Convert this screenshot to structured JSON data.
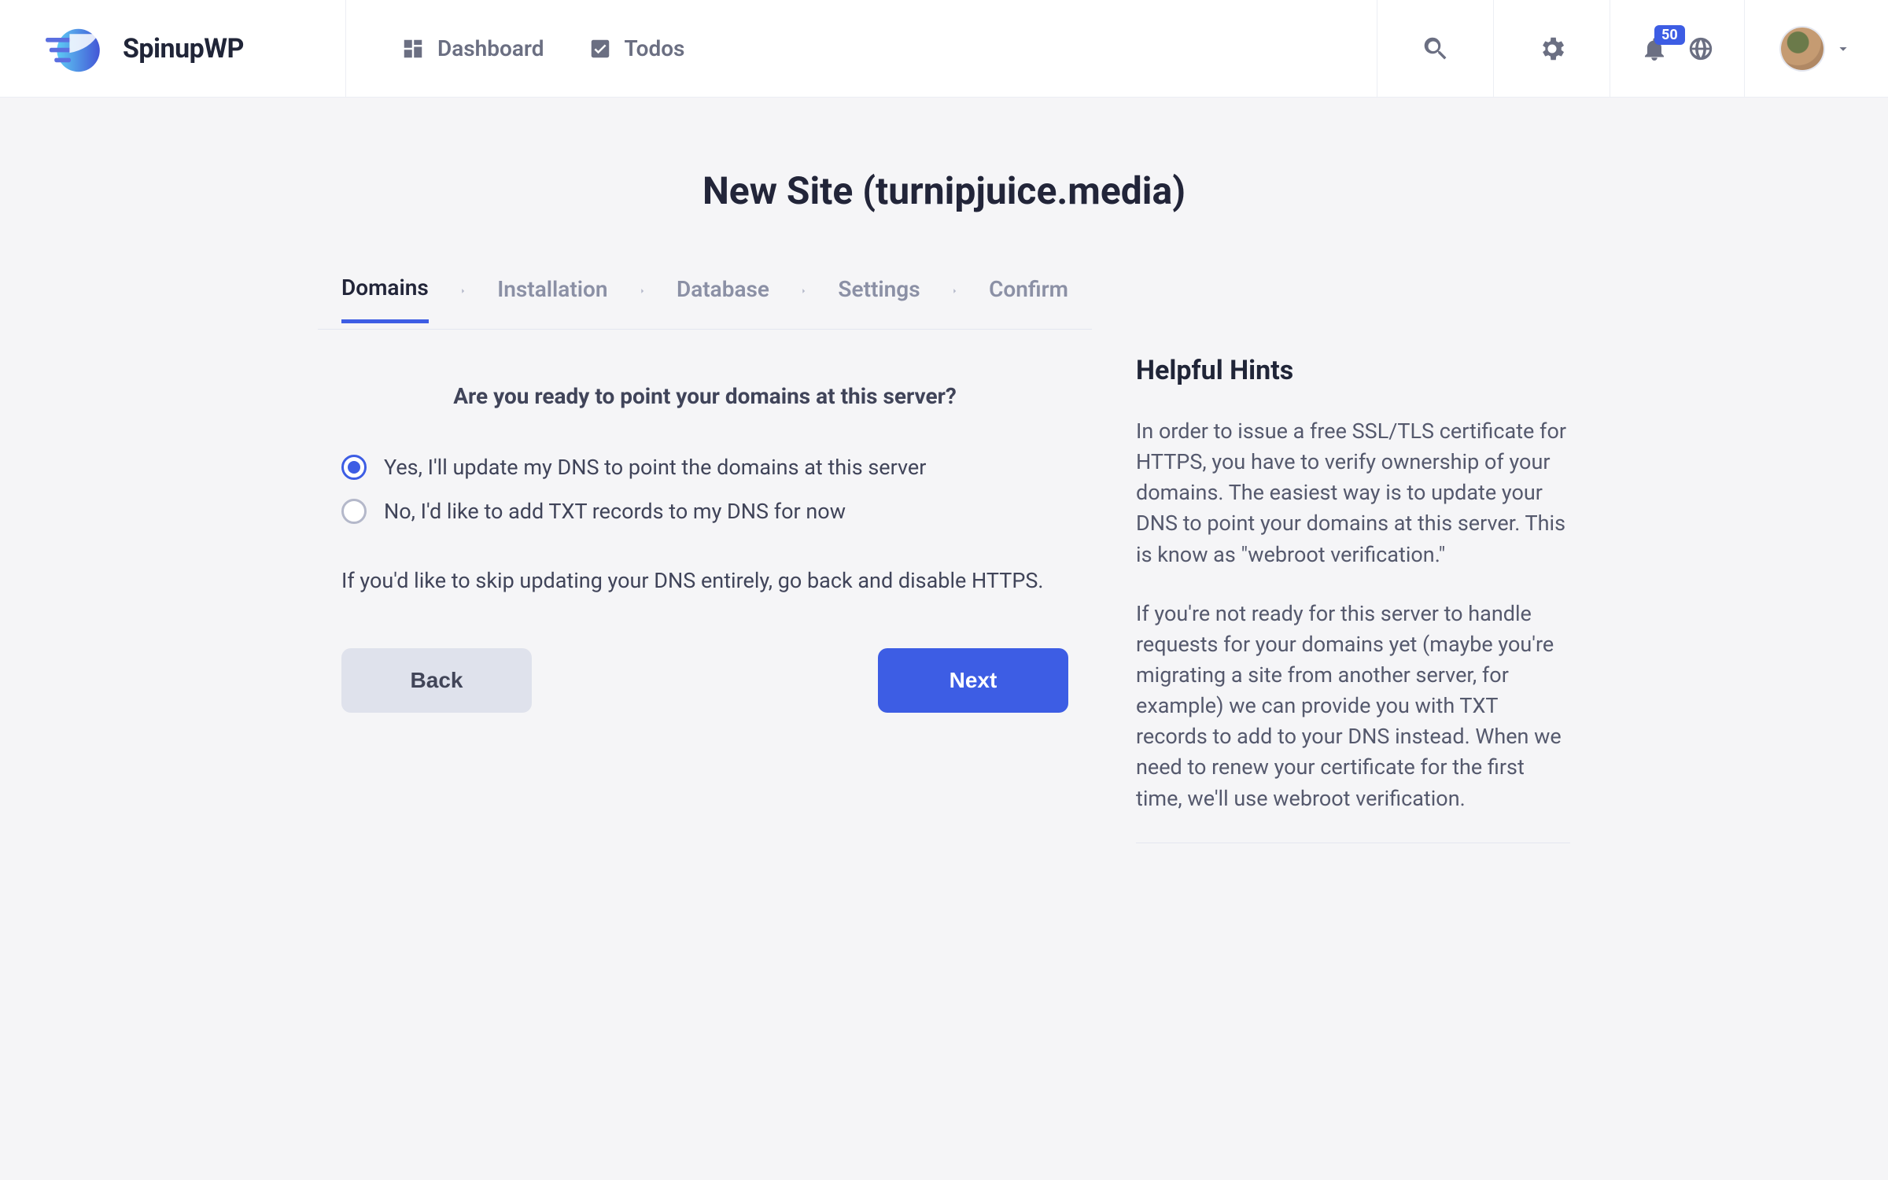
{
  "brand": "SpinupWP",
  "nav": {
    "dashboard": "Dashboard",
    "todos": "Todos"
  },
  "notification_count": "50",
  "page_title": "New Site (turnipjuice.media)",
  "steps": {
    "domains": "Domains",
    "installation": "Installation",
    "database": "Database",
    "settings": "Settings",
    "confirm": "Confirm"
  },
  "form": {
    "question": "Are you ready to point your domains at this server?",
    "option_yes": "Yes, I'll update my DNS to point the domains at this server",
    "option_no": "No, I'd like to add TXT records to my DNS for now",
    "note": "If you'd like to skip updating your DNS entirely, go back and disable HTTPS.",
    "back": "Back",
    "next": "Next"
  },
  "hints": {
    "title": "Helpful Hints",
    "p1": "In order to issue a free SSL/TLS certificate for HTTPS, you have to verify ownership of your domains. The easiest way is to update your DNS to point your domains at this server. This is know as \"webroot verification.\"",
    "p2": "If you're not ready for this server to handle requests for your domains yet (maybe you're migrating a site from another server, for example) we can provide you with TXT records to add to your DNS instead. When we need to renew your certificate for the first time, we'll use webroot verification."
  }
}
